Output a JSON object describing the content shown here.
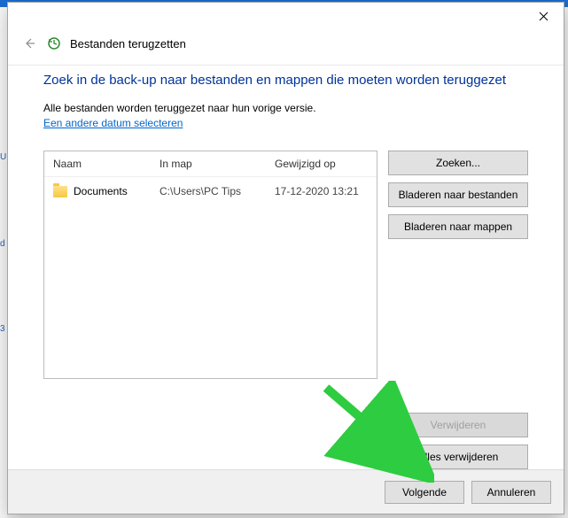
{
  "window": {
    "title": "Bestanden terugzetten"
  },
  "heading": "Zoek in de back-up naar bestanden en mappen die moeten worden teruggezet",
  "subtext": "Alle bestanden worden teruggezet naar hun vorige versie.",
  "link_select_date": "Een andere datum selecteren",
  "columns": {
    "name": "Naam",
    "path": "In map",
    "date": "Gewijzigd op"
  },
  "rows": [
    {
      "name": "Documents",
      "path": "C:\\Users\\PC Tips",
      "date": "17-12-2020 13:21"
    }
  ],
  "buttons": {
    "search": "Zoeken...",
    "browse_files": "Bladeren naar bestanden",
    "browse_folders": "Bladeren naar mappen",
    "remove": "Verwijderen",
    "remove_all": "Alles verwijderen",
    "next": "Volgende",
    "cancel": "Annuleren"
  },
  "left_sliver": {
    "a": "U",
    "b": "d",
    "c": "3"
  }
}
